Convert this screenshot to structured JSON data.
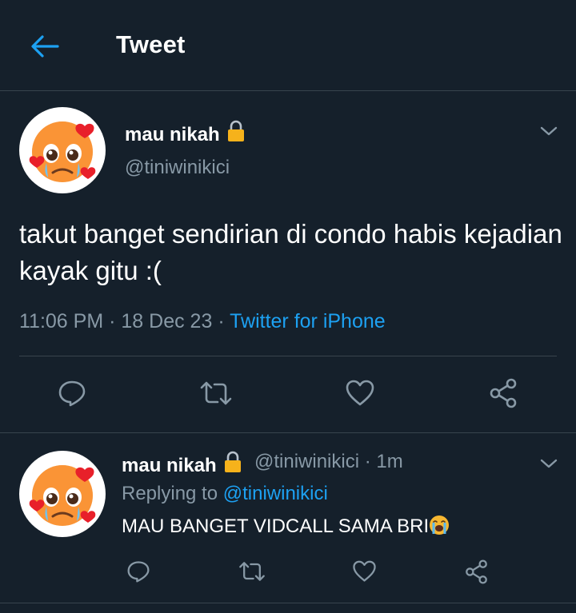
{
  "header": {
    "title": "Tweet",
    "back_icon": "arrow-left-icon"
  },
  "tweet": {
    "display_name": "mau nikah",
    "handle": "@tiniwinikici",
    "text": "takut banget sendirian di condo habis kejadian kayak gitu :(",
    "time": "11:06 PM",
    "date": "18 Dec 23",
    "source": "Twitter for iPhone",
    "sep": "·",
    "actions": [
      "reply-icon",
      "retweet-icon",
      "like-icon",
      "share-icon"
    ]
  },
  "reply": {
    "display_name": "mau nikah",
    "handle": "@tiniwinikici",
    "time": "1m",
    "replying_prefix": "Replying to",
    "replying_to": "@tiniwinikici",
    "text": "MAU BANGET VIDCALL SAMA BRI",
    "emoji": "loudly-crying-face-emoji"
  },
  "colors": {
    "background": "#15202b",
    "accent": "#1da1f2",
    "secondary_text": "#8899a6",
    "divider": "#38444d"
  }
}
